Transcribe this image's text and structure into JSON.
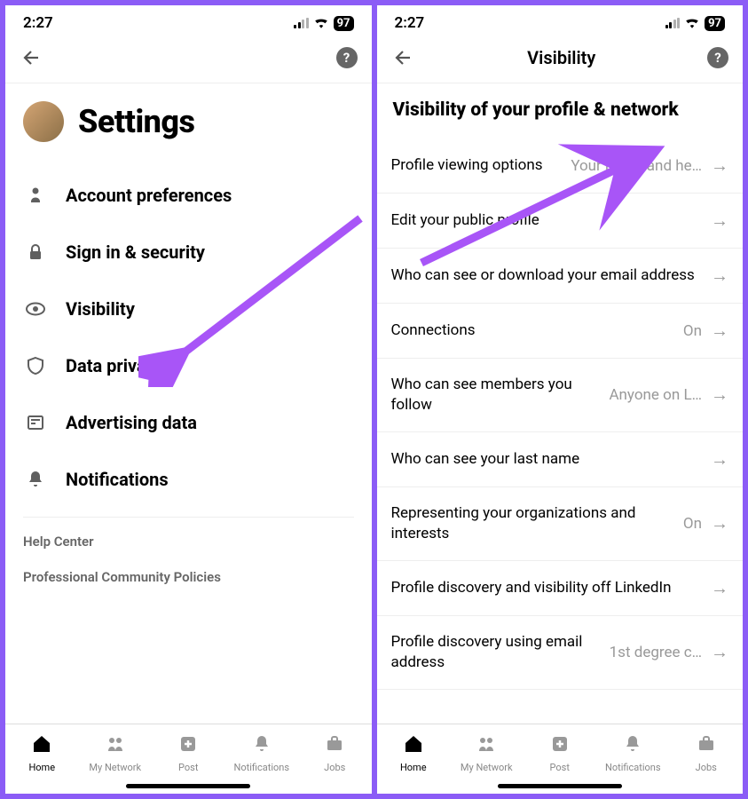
{
  "status": {
    "time": "2:27",
    "battery": "97"
  },
  "left": {
    "title": "Settings",
    "items": [
      {
        "icon": "person",
        "label": "Account preferences"
      },
      {
        "icon": "lock",
        "label": "Sign in & security"
      },
      {
        "icon": "eye",
        "label": "Visibility"
      },
      {
        "icon": "shield",
        "label": "Data privacy"
      },
      {
        "icon": "newspaper",
        "label": "Advertising data"
      },
      {
        "icon": "bell",
        "label": "Notifications"
      }
    ],
    "helpLinks": [
      "Help Center",
      "Professional Community Policies"
    ]
  },
  "right": {
    "navTitle": "Visibility",
    "sectionTitle": "Visibility of your profile & network",
    "rows": [
      {
        "label": "Profile viewing options",
        "value": "Your name and he…"
      },
      {
        "label": "Edit your public profile",
        "value": ""
      },
      {
        "label": "Who can see or download your email address",
        "value": ""
      },
      {
        "label": "Connections",
        "value": "On"
      },
      {
        "label": "Who can see members you follow",
        "value": "Anyone on L…"
      },
      {
        "label": "Who can see your last name",
        "value": ""
      },
      {
        "label": "Representing your organizations and interests",
        "value": "On"
      },
      {
        "label": "Profile discovery and visibility off LinkedIn",
        "value": ""
      },
      {
        "label": "Profile discovery using email address",
        "value": "1st degree c…"
      }
    ]
  },
  "bottomNav": [
    {
      "label": "Home",
      "icon": "home",
      "active": true
    },
    {
      "label": "My Network",
      "icon": "network",
      "active": false
    },
    {
      "label": "Post",
      "icon": "post",
      "active": false
    },
    {
      "label": "Notifications",
      "icon": "notif",
      "active": false
    },
    {
      "label": "Jobs",
      "icon": "jobs",
      "active": false
    }
  ]
}
